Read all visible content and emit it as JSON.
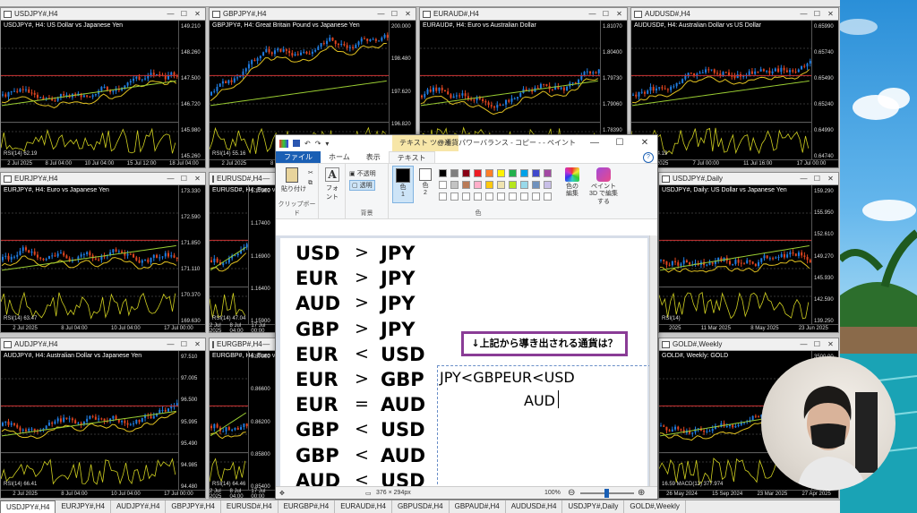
{
  "charts": [
    {
      "id": "c1",
      "title": "USDJPY#,H4",
      "overlay": "USDJPY#, H4:  US Dollar vs Japanese Yen",
      "rsi": "RSI(14) 62.19",
      "prices": [
        "149.210",
        "148.260",
        "147.500",
        "146.720",
        "145.980",
        "145.260"
      ],
      "times": [
        "2 Jul 2025",
        "8 Jul 04:00",
        "10 Jul 04:00",
        "15 Jul 12:00",
        "18 Jul 04:00"
      ]
    },
    {
      "id": "c2",
      "title": "GBPJPY#,H4",
      "overlay": "GBPJPY#, H4:  Great Britain Pound vs Japanese Yen",
      "rsi": "RSI(14) 55.16",
      "prices": [
        "200.000",
        "198.480",
        "197.620",
        "196.820",
        "196.005"
      ],
      "times": [
        "2 Jul 2025",
        "8 Jul 04:00",
        "10 Jul 04:00",
        "17 Jul 00:00"
      ]
    },
    {
      "id": "c3",
      "title": "EURAUD#,H4",
      "overlay": "EURAUD#, H4:  Euro vs Australian Dollar",
      "rsi": "RSI(14) 60.10",
      "prices": [
        "1.81070",
        "1.80400",
        "1.79730",
        "1.79060",
        "1.78390",
        "1.77720"
      ],
      "times": [
        "2 Jul 2025",
        "7 Jul 04:00",
        "11 Jul 16:00",
        "17 Jul 00:00"
      ]
    },
    {
      "id": "c4",
      "title": "AUDUSD#,H4",
      "overlay": "AUDUSD#, H4:  Australian Dollar vs US Dollar",
      "rsi": "RSI(14) 44.19",
      "prices": [
        "0.65990",
        "0.65740",
        "0.65490",
        "0.65240",
        "0.64990",
        "0.64740"
      ],
      "times": [
        "2 Jul 2025",
        "7 Jul 00:00",
        "11 Jul 16:00",
        "17 Jul 00:00"
      ]
    },
    {
      "id": "c5",
      "title": "EURJPY#,H4",
      "overlay": "EURJPY#, H4:  Euro vs Japanese Yen",
      "rsi": "RSI(14) 63.47",
      "prices": [
        "173.330",
        "172.590",
        "171.850",
        "171.110",
        "170.370",
        "169.630"
      ],
      "times": [
        "2 Jul 2025",
        "8 Jul 04:00",
        "10 Jul 04:00",
        "17 Jul 00:00"
      ]
    },
    {
      "id": "c6",
      "title": "EURUSD#,H4",
      "overlay": "EURUSD#, H4:  Euro vs US Dollar",
      "rsi": "RSI(14) 47.04",
      "prices": [
        "1.17900",
        "1.17400",
        "1.16900",
        "1.16400",
        "1.15900"
      ],
      "times": [
        "2 Jul 2025",
        "8 Jul 04:00",
        "17 Jul 00:00"
      ]
    },
    {
      "id": "c7",
      "title": "USDJPY#,Daily",
      "overlay": "USDJPY#, Daily:  US Dollar vs Japanese Yen",
      "rsi": "RSI(14)",
      "prices": [
        "159.290",
        "155.950",
        "152.610",
        "149.270",
        "145.930",
        "142.590",
        "139.250"
      ],
      "times": [
        "2025",
        "11 Mar 2025",
        "8 May 2025",
        "23 Jun 2025"
      ]
    },
    {
      "id": "c8",
      "title": "AUDJPY#,H4",
      "overlay": "AUDJPY#, H4:  Australian Dollar vs Japanese Yen",
      "rsi": "RSI(14) 66.41",
      "prices": [
        "97.510",
        "97.005",
        "96.500",
        "95.995",
        "95.490",
        "94.985",
        "94.480"
      ],
      "times": [
        "2 Jul 2025",
        "8 Jul 04:00",
        "10 Jul 04:00",
        "17 Jul 00:00"
      ]
    },
    {
      "id": "c9",
      "title": "EURGBP#,H4",
      "overlay": "EURGBP#, H4:  Euro vs Great Britain Pound",
      "rsi": "RSI(14) 64.46",
      "prices": [
        "0.87000",
        "0.86600",
        "0.86200",
        "0.85800",
        "0.85400"
      ],
      "times": [
        "2 Jul 2025",
        "8 Jul 04:00",
        "17 Jul 00:00"
      ]
    },
    {
      "id": "c10",
      "title": "GOLD#,Weekly",
      "overlay": "GOLD#, Weekly:  GOLD",
      "rsi": "16.59 MACD(12) 377.974",
      "prices": [
        "3500.00",
        "3000.00",
        "2500.00",
        "2000.00",
        "1500.00"
      ],
      "times": [
        "26 May 2024",
        "15 Sep 2024",
        "23 Mar 2025",
        "27 Apr 2025"
      ]
    }
  ],
  "bottom_tabs": [
    "USDJPY#,H4",
    "EURJPY#,H4",
    "AUDJPY#,H4",
    "GBPJPY#,H4",
    "EURUSD#,H4",
    "EURGBP#,H4",
    "EURAUD#,H4",
    "GBPUSD#,H4",
    "GBPAUD#,H4",
    "AUDUSD#,H4",
    "USDJPY#,Daily",
    "GOLD#,Weekly"
  ],
  "paint": {
    "title": "@通貨パワーバランス - コピー - - ペイント",
    "context_tab": "テキスト ツール",
    "tabs": {
      "file": "ファイル",
      "home": "ホーム",
      "view": "表示",
      "text": "テキスト"
    },
    "ribbon": {
      "paste": "貼り付け",
      "clipboard": "クリップボード",
      "font": "フォント",
      "opaque": "不透明",
      "transparent": "透明",
      "background": "背景",
      "color1": "色",
      "color1_num": "1",
      "color2": "色",
      "color2_num": "2",
      "color_group": "色",
      "edit_colors": "色の編集",
      "paint3d": "ペイント 3D で編集する"
    },
    "palette": [
      "#000000",
      "#7f7f7f",
      "#880015",
      "#ed1c24",
      "#ff7f27",
      "#fff200",
      "#22b14c",
      "#00a2e8",
      "#3f48cc",
      "#a349a4",
      "#ffffff",
      "#c3c3c3",
      "#b97a57",
      "#ffaec9",
      "#ffc90e",
      "#efe4b0",
      "#b5e61d",
      "#99d9ea",
      "#7092be",
      "#c8bfe7"
    ],
    "relations": [
      {
        "left": "USD",
        "op": ">",
        "right": "JPY"
      },
      {
        "left": "EUR",
        "op": ">",
        "right": "JPY"
      },
      {
        "left": "AUD",
        "op": ">",
        "right": "JPY"
      },
      {
        "left": "GBP",
        "op": ">",
        "right": "JPY"
      },
      {
        "left": "EUR",
        "op": "<",
        "right": "USD"
      },
      {
        "left": "EUR",
        "op": ">",
        "right": "GBP"
      },
      {
        "left": "EUR",
        "op": "=",
        "right": "AUD"
      },
      {
        "left": "GBP",
        "op": "<",
        "right": "USD"
      },
      {
        "left": "GBP",
        "op": "<",
        "right": "AUD"
      },
      {
        "left": "AUD",
        "op": "<",
        "right": "USD"
      }
    ],
    "note": "↓上記から導き出される通貨は？",
    "result_line1": "JPY<GBPEUR<USD",
    "result_line2": "AUD",
    "status_size": "376 × 294px",
    "zoom": "100%"
  }
}
